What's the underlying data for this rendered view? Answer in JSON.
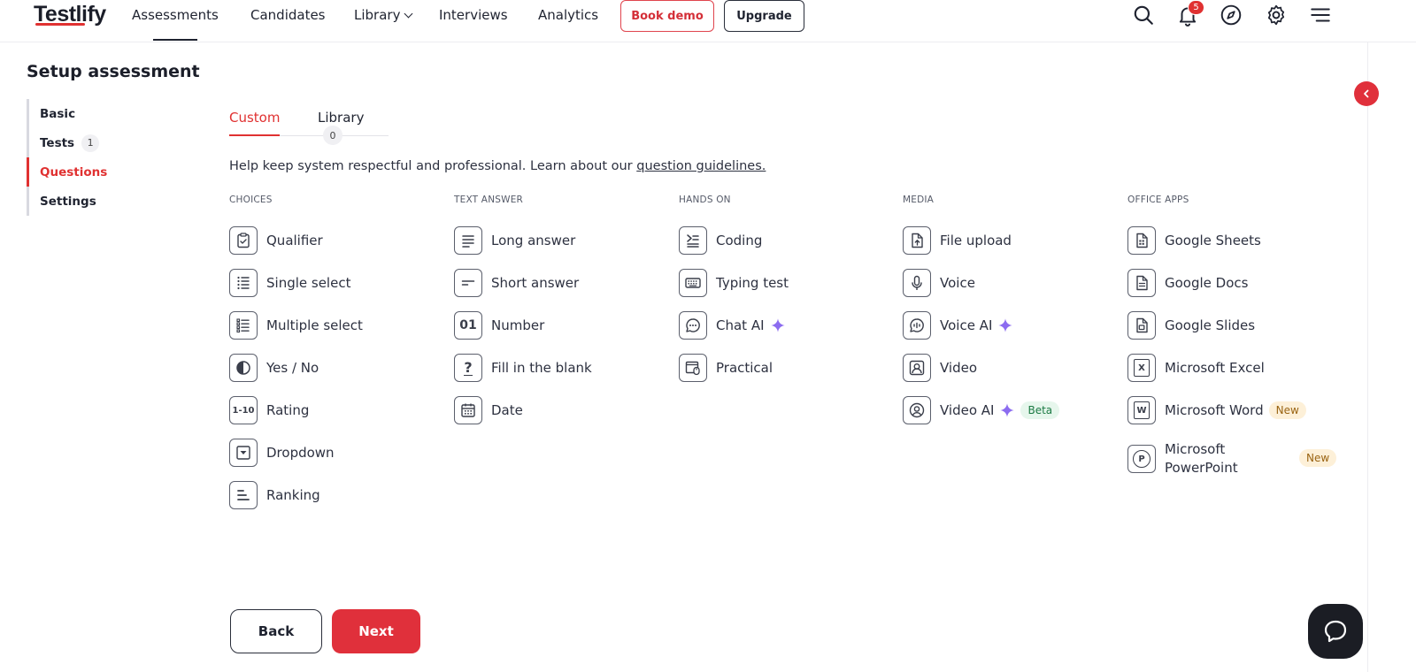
{
  "brand": {
    "name": "Testlify",
    "accent": "#e03131"
  },
  "nav": {
    "items": [
      "Assessments",
      "Candidates",
      "Library",
      "Interviews",
      "Analytics"
    ],
    "book_demo": "Book demo",
    "upgrade": "Upgrade",
    "notifications_count": "5",
    "icons": [
      "search-icon",
      "bell-icon",
      "compass-icon",
      "gear-icon",
      "menu-icon"
    ]
  },
  "page": {
    "title": "Setup assessment"
  },
  "steps": [
    {
      "label": "Basic",
      "count": ""
    },
    {
      "label": "Tests",
      "count": "1"
    },
    {
      "label": "Questions",
      "count": ""
    },
    {
      "label": "Settings",
      "count": ""
    }
  ],
  "tabs": {
    "custom": "Custom",
    "library": "Library",
    "library_count": "0"
  },
  "help": {
    "text": "Help keep system respectful and professional. Learn about our ",
    "link": "question guidelines."
  },
  "columns": [
    {
      "heading": "CHOICES",
      "items": [
        {
          "label": "Qualifier"
        },
        {
          "label": "Single select"
        },
        {
          "label": "Multiple select"
        },
        {
          "label": "Yes / No"
        },
        {
          "label": "Rating",
          "icon_text": "1-10"
        },
        {
          "label": "Dropdown"
        },
        {
          "label": "Ranking"
        }
      ]
    },
    {
      "heading": "TEXT ANSWER",
      "items": [
        {
          "label": "Long answer"
        },
        {
          "label": "Short answer"
        },
        {
          "label": "Number",
          "icon_text": "01"
        },
        {
          "label": "Fill in the blank",
          "icon_text": "?"
        },
        {
          "label": "Date"
        }
      ]
    },
    {
      "heading": "HANDS ON",
      "items": [
        {
          "label": "Coding"
        },
        {
          "label": "Typing test"
        },
        {
          "label": "Chat AI"
        },
        {
          "label": "Practical"
        }
      ]
    },
    {
      "heading": "MEDIA",
      "items": [
        {
          "label": "File upload"
        },
        {
          "label": "Voice"
        },
        {
          "label": "Voice AI"
        },
        {
          "label": "Video"
        },
        {
          "label": "Video AI",
          "badge": "Beta"
        }
      ]
    },
    {
      "heading": "OFFICE APPS",
      "items": [
        {
          "label": "Google Sheets"
        },
        {
          "label": "Google Docs"
        },
        {
          "label": "Google Slides"
        },
        {
          "label": "Microsoft Excel",
          "icon_text": "X"
        },
        {
          "label": "Microsoft Word",
          "icon_text": "W",
          "badge": "New"
        },
        {
          "label": "Microsoft PowerPoint",
          "icon_text": "P",
          "badge": "New"
        }
      ]
    }
  ],
  "footer": {
    "back": "Back",
    "next": "Next"
  }
}
